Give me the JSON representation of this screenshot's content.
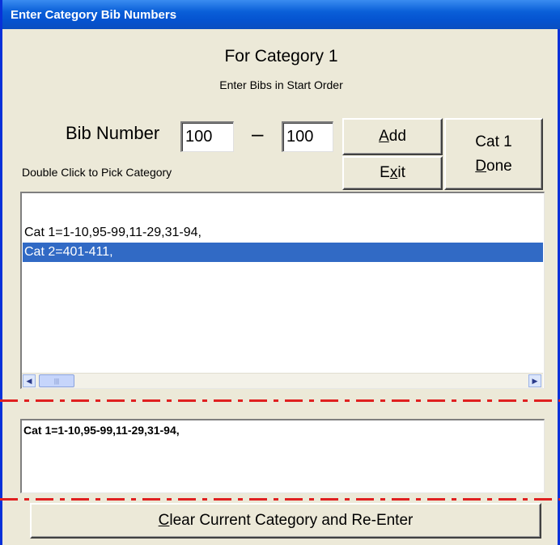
{
  "window": {
    "title": "Enter Category Bib Numbers"
  },
  "header": {
    "title": "For Category 1",
    "subtitle": "Enter Bibs in Start Order"
  },
  "bib": {
    "label": "Bib Number",
    "from_value": "100",
    "separator": "–",
    "to_value": "100"
  },
  "buttons": {
    "add": {
      "pre": "",
      "key": "A",
      "post": "dd"
    },
    "exit": {
      "pre": "E",
      "key": "x",
      "post": "it"
    },
    "cat_done": {
      "line1": "Cat 1",
      "line2_pre": "",
      "line2_key": "D",
      "line2_post": "one"
    },
    "clear": {
      "pre": "",
      "key": "C",
      "post": "lear Current Category and Re-Enter"
    }
  },
  "hint": "Double Click to Pick Category",
  "category_list": {
    "items": [
      {
        "text": "Cat 1=1-10,95-99,11-29,31-94,"
      },
      {
        "text": "Cat 2=401-411,",
        "selected": true
      }
    ]
  },
  "current": {
    "text": "Cat 1=1-10,95-99,11-29,31-94,"
  },
  "icons": {
    "scroll_left": "left-arrow-icon",
    "scroll_right": "right-arrow-icon",
    "thumb_grip": "grip-icon"
  },
  "colors": {
    "titlebar": "#0a5fd8",
    "selection": "#316ac5",
    "annotation_dashes": "#e02020",
    "window_bg": "#ece9d8"
  }
}
